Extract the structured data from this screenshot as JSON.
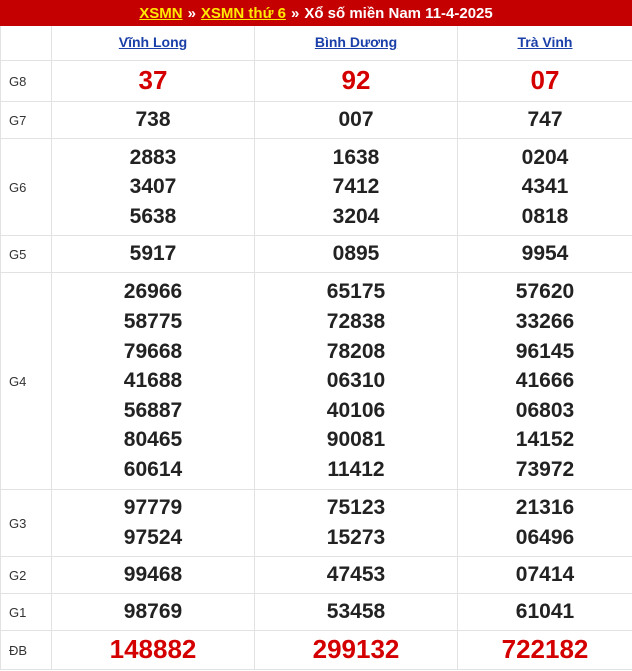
{
  "header": {
    "link1": "XSMN",
    "sep1": "»",
    "link2": "XSMN thứ 6",
    "sep2": "»",
    "title": "Xổ số miền Nam 11-4-2025"
  },
  "provinces": [
    "Vĩnh Long",
    "Bình Dương",
    "Trà Vinh"
  ],
  "prizes": [
    {
      "label": "G8",
      "cols": [
        [
          "37"
        ],
        [
          "92"
        ],
        [
          "07"
        ]
      ]
    },
    {
      "label": "G7",
      "cols": [
        [
          "738"
        ],
        [
          "007"
        ],
        [
          "747"
        ]
      ]
    },
    {
      "label": "G6",
      "cols": [
        [
          "2883",
          "3407",
          "5638"
        ],
        [
          "1638",
          "7412",
          "3204"
        ],
        [
          "0204",
          "4341",
          "0818"
        ]
      ]
    },
    {
      "label": "G5",
      "cols": [
        [
          "5917"
        ],
        [
          "0895"
        ],
        [
          "9954"
        ]
      ]
    },
    {
      "label": "G4",
      "cols": [
        [
          "26966",
          "58775",
          "79668",
          "41688",
          "56887",
          "80465",
          "60614"
        ],
        [
          "65175",
          "72838",
          "78208",
          "06310",
          "40106",
          "90081",
          "11412"
        ],
        [
          "57620",
          "33266",
          "96145",
          "41666",
          "06803",
          "14152",
          "73972"
        ]
      ]
    },
    {
      "label": "G3",
      "cols": [
        [
          "97779",
          "97524"
        ],
        [
          "75123",
          "15273"
        ],
        [
          "21316",
          "06496"
        ]
      ]
    },
    {
      "label": "G2",
      "cols": [
        [
          "99468"
        ],
        [
          "47453"
        ],
        [
          "07414"
        ]
      ]
    },
    {
      "label": "G1",
      "cols": [
        [
          "98769"
        ],
        [
          "53458"
        ],
        [
          "61041"
        ]
      ]
    },
    {
      "label": "ĐB",
      "cols": [
        [
          "148882"
        ],
        [
          "299132"
        ],
        [
          "722182"
        ]
      ]
    }
  ],
  "colors": {
    "header_bg": "#c40000",
    "header_link": "#ffea00",
    "highlight": "#d40000",
    "province_link": "#1a3fa8"
  }
}
